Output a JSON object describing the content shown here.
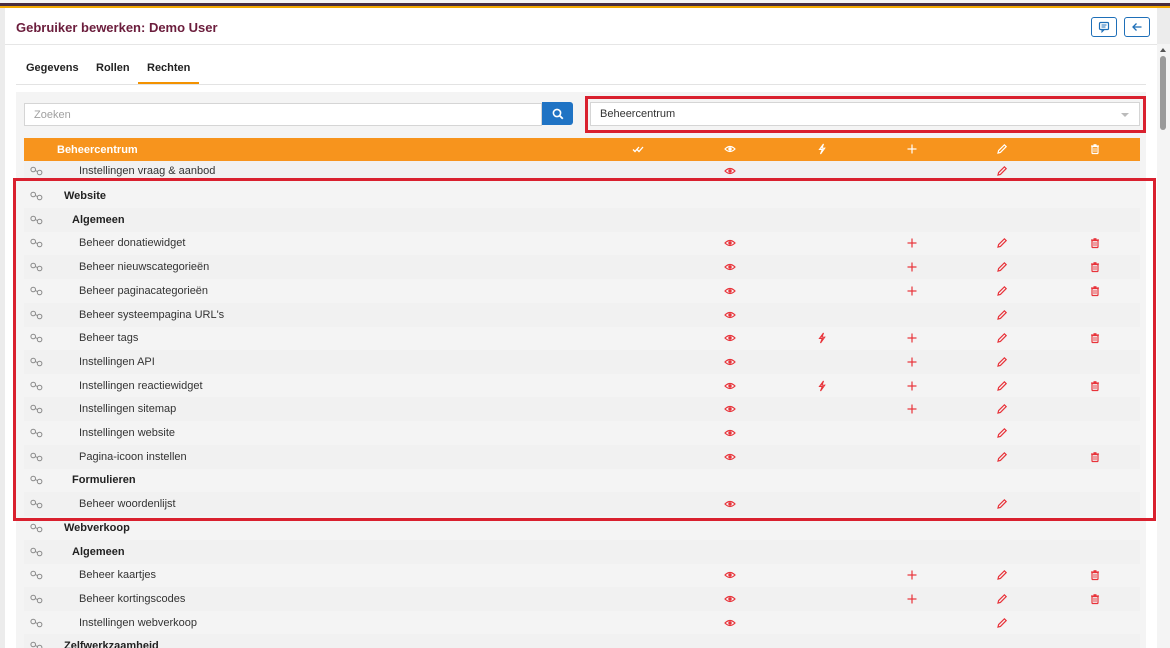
{
  "header": {
    "title": "Gebruiker bewerken: Demo User",
    "buttons": [
      {
        "icon": "message-icon"
      },
      {
        "icon": "arrow-left-icon"
      }
    ]
  },
  "tabs": [
    {
      "label": "Gegevens",
      "active": false
    },
    {
      "label": "Rollen",
      "active": false
    },
    {
      "label": "Rechten",
      "active": true
    }
  ],
  "search": {
    "placeholder": "Zoeken",
    "value": ""
  },
  "module_select": {
    "selected": "Beheercentrum"
  },
  "table": {
    "title": "Beheercentrum",
    "column_icons": [
      "double-check-icon",
      "eye-icon",
      "lightning-icon",
      "plus-icon",
      "pencil-icon",
      "trash-icon"
    ],
    "rows": [
      {
        "label": "Instellingen vraag & aanbod",
        "level": 2,
        "perms": {
          "view": true,
          "exec": false,
          "add": false,
          "edit": true,
          "del": false
        }
      },
      {
        "label": "Website",
        "level": 0,
        "perms": {}
      },
      {
        "label": "Algemeen",
        "level": 1,
        "perms": {}
      },
      {
        "label": "Beheer donatiewidget",
        "level": 2,
        "perms": {
          "view": true,
          "exec": false,
          "add": true,
          "edit": true,
          "del": true
        }
      },
      {
        "label": "Beheer nieuwscategorieën",
        "level": 2,
        "perms": {
          "view": true,
          "exec": false,
          "add": true,
          "edit": true,
          "del": true
        }
      },
      {
        "label": "Beheer paginacategorieën",
        "level": 2,
        "perms": {
          "view": true,
          "exec": false,
          "add": true,
          "edit": true,
          "del": true
        }
      },
      {
        "label": "Beheer systeempagina URL's",
        "level": 2,
        "perms": {
          "view": true,
          "exec": false,
          "add": false,
          "edit": true,
          "del": false
        }
      },
      {
        "label": "Beheer tags",
        "level": 2,
        "perms": {
          "view": true,
          "exec": true,
          "add": true,
          "edit": true,
          "del": true
        }
      },
      {
        "label": "Instellingen API",
        "level": 2,
        "perms": {
          "view": true,
          "exec": false,
          "add": true,
          "edit": true,
          "del": false
        }
      },
      {
        "label": "Instellingen reactiewidget",
        "level": 2,
        "perms": {
          "view": true,
          "exec": true,
          "add": true,
          "edit": true,
          "del": true
        }
      },
      {
        "label": "Instellingen sitemap",
        "level": 2,
        "perms": {
          "view": true,
          "exec": false,
          "add": true,
          "edit": true,
          "del": false
        }
      },
      {
        "label": "Instellingen website",
        "level": 2,
        "perms": {
          "view": true,
          "exec": false,
          "add": false,
          "edit": true,
          "del": false
        }
      },
      {
        "label": "Pagina-icoon instellen",
        "level": 2,
        "perms": {
          "view": true,
          "exec": false,
          "add": false,
          "edit": true,
          "del": true
        }
      },
      {
        "label": "Formulieren",
        "level": 1,
        "perms": {}
      },
      {
        "label": "Beheer woordenlijst",
        "level": 2,
        "perms": {
          "view": true,
          "exec": false,
          "add": false,
          "edit": true,
          "del": false
        }
      },
      {
        "label": "Webverkoop",
        "level": 0,
        "perms": {}
      },
      {
        "label": "Algemeen",
        "level": 1,
        "perms": {}
      },
      {
        "label": "Beheer kaartjes",
        "level": 2,
        "perms": {
          "view": true,
          "exec": false,
          "add": true,
          "edit": true,
          "del": true
        }
      },
      {
        "label": "Beheer kortingscodes",
        "level": 2,
        "perms": {
          "view": true,
          "exec": false,
          "add": true,
          "edit": true,
          "del": true
        }
      },
      {
        "label": "Instellingen webverkoop",
        "level": 2,
        "perms": {
          "view": true,
          "exec": false,
          "add": false,
          "edit": true,
          "del": false
        }
      },
      {
        "label": "Zelfwerkzaamheid",
        "level": 0,
        "perms": {}
      }
    ]
  },
  "colors": {
    "accent": "#f7941d",
    "permission": "#e8333a",
    "brand": "#6b1d3c",
    "primary": "#1f73c4",
    "highlight": "#d9202e"
  }
}
